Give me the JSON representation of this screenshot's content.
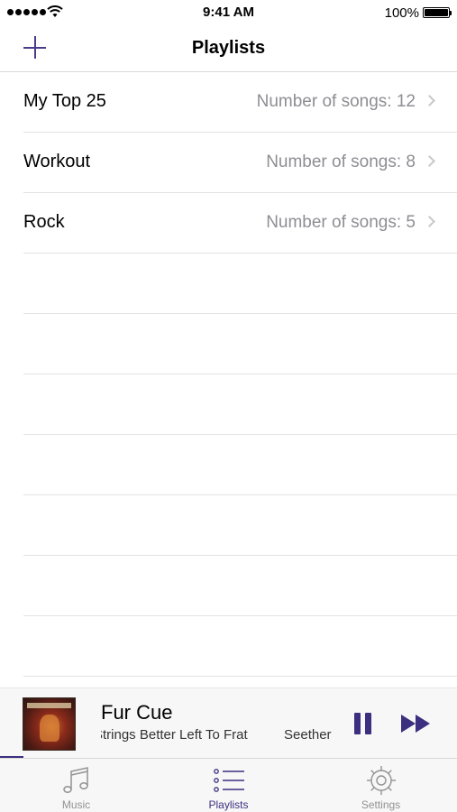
{
  "status_bar": {
    "time": "9:41 AM",
    "battery_percent": "100%"
  },
  "nav": {
    "title": "Playlists",
    "add_icon": "plus-icon"
  },
  "playlists": [
    {
      "title": "My Top 25",
      "detail": "Number of songs: 12"
    },
    {
      "title": "Workout",
      "detail": "Number of songs: 8"
    },
    {
      "title": "Rock",
      "detail": "Number of songs: 5"
    }
  ],
  "now_playing": {
    "title": "Fur Cue",
    "subtitle_album": "Strings Better Left To Frat",
    "subtitle_artist": "Seether",
    "pause_icon": "pause-icon",
    "forward_icon": "fast-forward-icon"
  },
  "tabs": [
    {
      "label": "Music",
      "icon": "music-note-icon",
      "active": false
    },
    {
      "label": "Playlists",
      "icon": "list-icon",
      "active": true
    },
    {
      "label": "Settings",
      "icon": "gear-icon",
      "active": false
    }
  ],
  "colors": {
    "accent": "#3c2f80",
    "secondary_text": "#8e8e93",
    "inactive_tab": "#929292"
  }
}
